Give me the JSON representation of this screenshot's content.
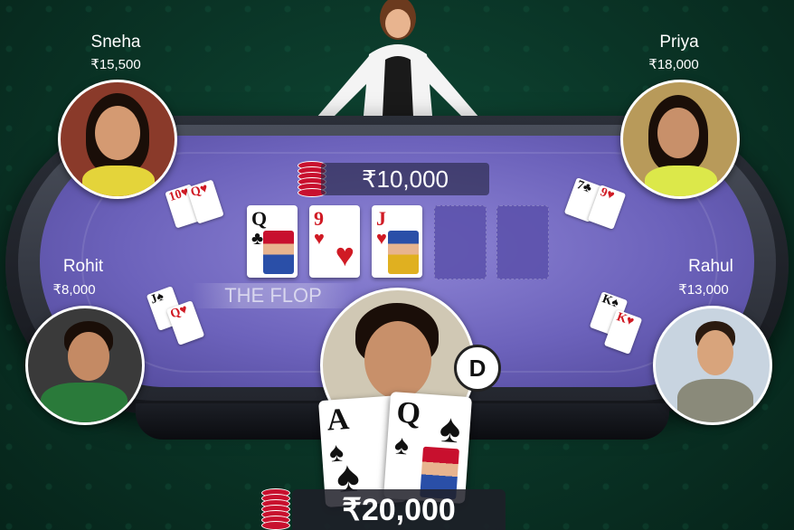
{
  "pot": {
    "amount": "₹10,000"
  },
  "stage": {
    "label": "THE FLOP"
  },
  "dealer_button": {
    "label": "D"
  },
  "players": {
    "sneha": {
      "name": "Sneha",
      "stack": "₹15,500"
    },
    "priya": {
      "name": "Priya",
      "stack": "₹18,000"
    },
    "rohit": {
      "name": "Rohit",
      "stack": "₹8,000"
    },
    "rahul": {
      "name": "Rahul",
      "stack": "₹13,000"
    }
  },
  "community_cards": [
    {
      "rank": "Q",
      "suit": "♣",
      "color": "#111111"
    },
    {
      "rank": "9",
      "suit": "♥",
      "color": "#d01a24"
    },
    {
      "rank": "J",
      "suit": "♥",
      "color": "#d01a24"
    }
  ],
  "player_cards": {
    "sneha": [
      "10♥",
      "Q♥"
    ],
    "priya": [
      "7♣",
      "9♥"
    ],
    "rohit": [
      "J♠",
      "Q♥"
    ],
    "rahul": [
      "K♠",
      "K♥"
    ]
  },
  "hero": {
    "cards": [
      {
        "rank": "A",
        "suit": "♠"
      },
      {
        "rank": "Q",
        "suit": "♠"
      }
    ],
    "stack": "₹20,000"
  },
  "colors": {
    "felt": "#6c62bb",
    "background": "#0a3426",
    "chip": "#c8102e"
  }
}
